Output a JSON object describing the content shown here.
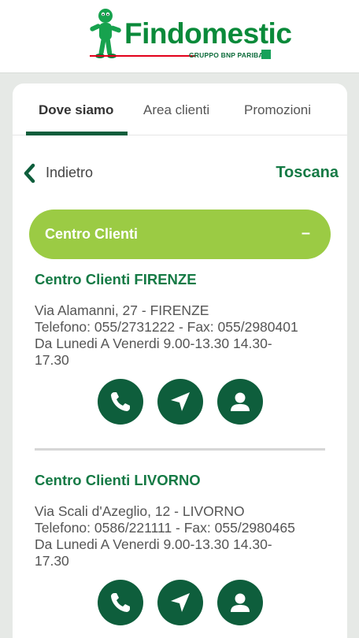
{
  "header": {
    "logo_text": "Findomestic",
    "logo_subtitle": "GRUPPO BNP PARIBAS"
  },
  "tabs": [
    {
      "label": "Dove siamo",
      "active": true
    },
    {
      "label": "Area clienti",
      "active": false
    },
    {
      "label": "Promozioni",
      "active": false
    }
  ],
  "nav": {
    "back_label": "Indietro",
    "back_icon": "chevron-left-icon",
    "region": "Toscana"
  },
  "section": {
    "title": "Centro Clienti",
    "toggle": "–"
  },
  "branches": [
    {
      "name": "Centro Clienti FIRENZE",
      "address": "Via Alamanni, 27 - FIRENZE",
      "phone": "Telefono: 055/2731222 - Fax: 055/2980401",
      "hours_1": "Da Lunedi A Venerdi 9.00-13.30 14.30-",
      "hours_2": "17.30"
    },
    {
      "name": "Centro Clienti LIVORNO",
      "address": "Via Scali d'Azeglio, 12 - LIVORNO",
      "phone": "Telefono: 0586/221111 - Fax: 055/2980465",
      "hours_1": "Da Lunedi A Venerdi 9.00-13.30 14.30-",
      "hours_2": "17.30"
    }
  ],
  "action_icons": [
    "phone-icon",
    "navigate-icon",
    "contact-icon"
  ],
  "colors": {
    "brand_green": "#0a8a3a",
    "dark_green": "#0e5e3c",
    "accordion_green": "#9bcb44",
    "heading_green": "#157a45",
    "logo_red": "#e2001a",
    "background": "#e6e9e6"
  }
}
